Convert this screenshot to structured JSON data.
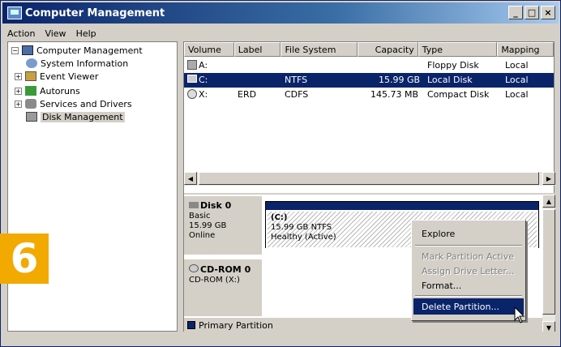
{
  "window": {
    "title": "Computer Management",
    "controls": [
      "_",
      "□",
      "×"
    ]
  },
  "menu": [
    "Action",
    "View",
    "Help"
  ],
  "tree": [
    {
      "label": "Computer Management",
      "expander": "−",
      "icon": "computer-icon"
    },
    {
      "label": "System Information",
      "expander": "",
      "icon": "info-icon"
    },
    {
      "label": "Event Viewer",
      "expander": "+",
      "icon": "event-viewer-icon"
    },
    {
      "label": "Autoruns",
      "expander": "+",
      "icon": "autoruns-icon"
    },
    {
      "label": "Services and Drivers",
      "expander": "+",
      "icon": "services-icon"
    },
    {
      "label": "Disk Management",
      "expander": "",
      "icon": "disk-icon"
    }
  ],
  "volumes": {
    "columns": [
      "Volume",
      "Label",
      "File System",
      "Capacity",
      "Type",
      "Mapping"
    ],
    "rows": [
      {
        "volume": "A:",
        "label": "",
        "fs": "",
        "capacity": "",
        "type": "Floppy Disk",
        "mapping": "Local"
      },
      {
        "volume": "C:",
        "label": "",
        "fs": "NTFS",
        "capacity": "15.99 GB",
        "type": "Local Disk",
        "mapping": "Local"
      },
      {
        "volume": "X:",
        "label": "ERD",
        "fs": "CDFS",
        "capacity": "145.73 MB",
        "type": "Compact Disk",
        "mapping": "Local"
      }
    ]
  },
  "disks": [
    {
      "name": "Disk 0",
      "kind": "Basic",
      "size": "15.99 GB",
      "status": "Online"
    },
    {
      "name": "CD-ROM 0",
      "kind": "CD-ROM (X:)"
    }
  ],
  "partition": {
    "name": "(C:)",
    "detail": "15.99 GB NTFS",
    "health": "Healthy (Active)"
  },
  "legend": {
    "label": "Primary Partition",
    "color": "#0a246a"
  },
  "context_menu": [
    {
      "label": "Explore",
      "enabled": true
    },
    {
      "label": "Mark Partition Active",
      "enabled": false
    },
    {
      "label": "Assign Drive Letter...",
      "enabled": false
    },
    {
      "label": "Format...",
      "enabled": true
    },
    {
      "label": "Delete Partition...",
      "enabled": true
    }
  ],
  "step_badge": "6",
  "colors": {
    "badge": "#f2a900",
    "selection": "#0a246a"
  }
}
